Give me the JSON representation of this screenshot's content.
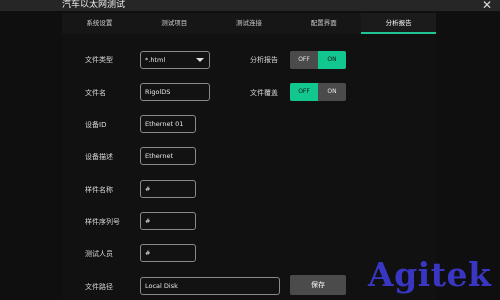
{
  "window": {
    "title": "汽车以太网测试",
    "close_icon": "close-icon"
  },
  "tabs": [
    {
      "label": "系统设置"
    },
    {
      "label": "测试项目"
    },
    {
      "label": "测试连接"
    },
    {
      "label": "配置界面"
    },
    {
      "label": "分析报告",
      "active": true
    }
  ],
  "form": {
    "file_type": {
      "label": "文件类型",
      "value": "*.html"
    },
    "file_name": {
      "label": "文件名",
      "value": "RigolDS"
    },
    "device_id": {
      "label": "设备ID",
      "value": "Ethernet 01"
    },
    "device_desc": {
      "label": "设备描述",
      "value": "Ethernet"
    },
    "sample_name": {
      "label": "样件名称",
      "value": "#"
    },
    "sample_serial": {
      "label": "样件序列号",
      "value": "#"
    },
    "tester": {
      "label": "测试人员",
      "value": "#"
    },
    "file_path": {
      "label": "文件路径",
      "value": "Local Disk"
    }
  },
  "options": {
    "analysis_report": {
      "label": "分析报告",
      "off_label": "OFF",
      "on_label": "ON",
      "state": "ON"
    },
    "file_overwrite": {
      "label": "文件覆盖",
      "off_label": "OFF",
      "on_label": "ON",
      "state": "OFF"
    }
  },
  "save_label": "保存",
  "watermark": "Agitek",
  "colors": {
    "accent": "#12c68f",
    "inactive": "#4b4b4b",
    "background": "#111111",
    "watermark": "#3a36c4"
  }
}
